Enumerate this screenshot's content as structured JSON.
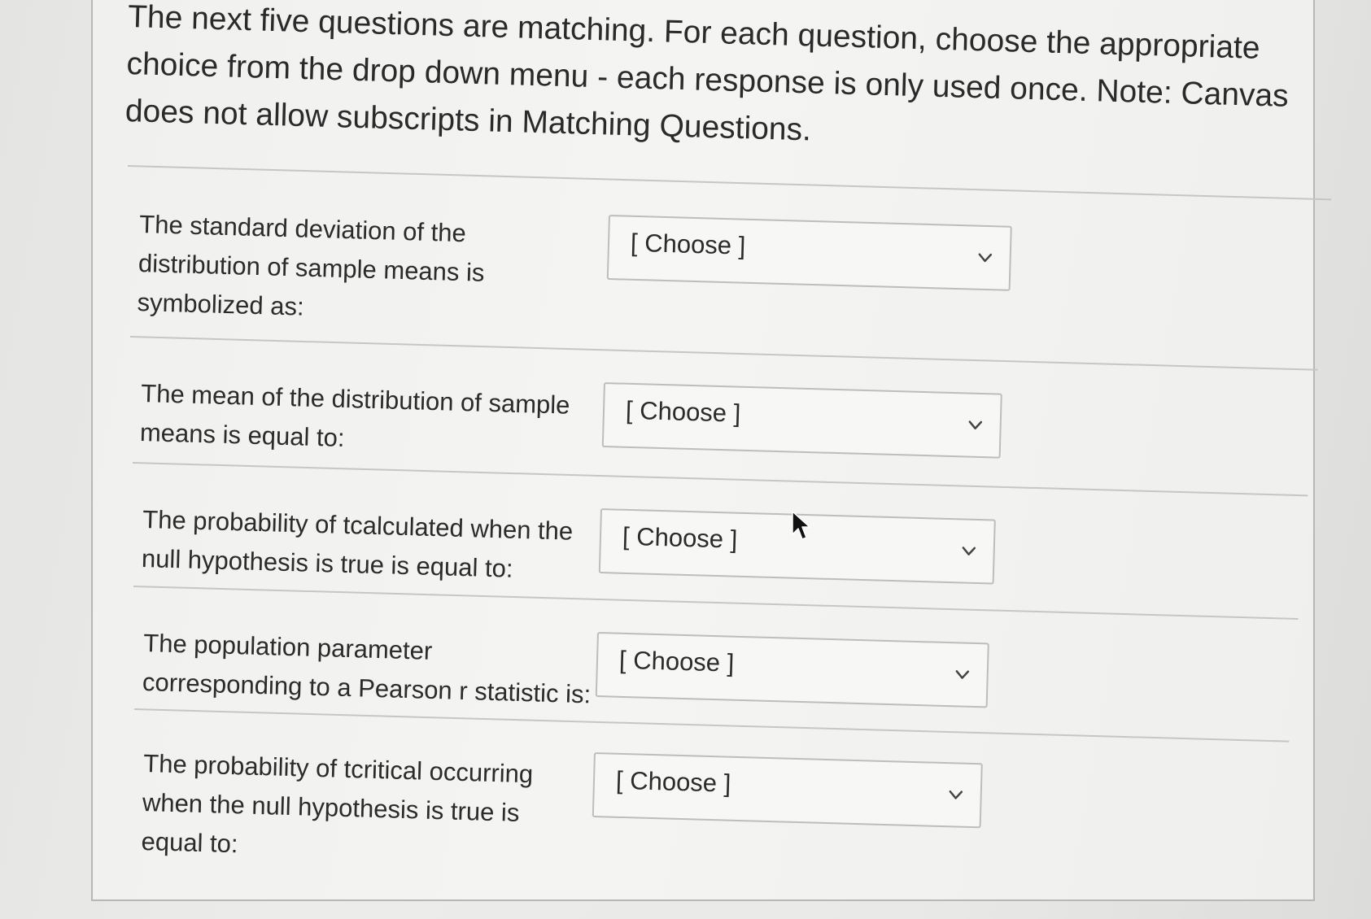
{
  "instructions": "The next five questions are matching. For each question, choose the appropriate choice from the drop down menu - each response is only used once. Note: Canvas does not allow subscripts in Matching Questions.",
  "questions": [
    {
      "prompt": "The standard deviation of the distribution of sample means is symbolized as:",
      "selected": "[ Choose ]"
    },
    {
      "prompt": "The mean of the distribution of sample means is equal to:",
      "selected": "[ Choose ]"
    },
    {
      "prompt": "The probability of tcalculated when the null hypothesis is true is equal to:",
      "selected": "[ Choose ]"
    },
    {
      "prompt": "The population parameter corresponding to a Pearson r statistic is:",
      "selected": "[ Choose ]"
    },
    {
      "prompt": "The probability of tcritical occurring when the null hypothesis is true is equal to:",
      "selected": "[ Choose ]"
    }
  ],
  "icons": {
    "dropdown": "chevron-down-icon",
    "pointer": "mouse-cursor-icon"
  }
}
